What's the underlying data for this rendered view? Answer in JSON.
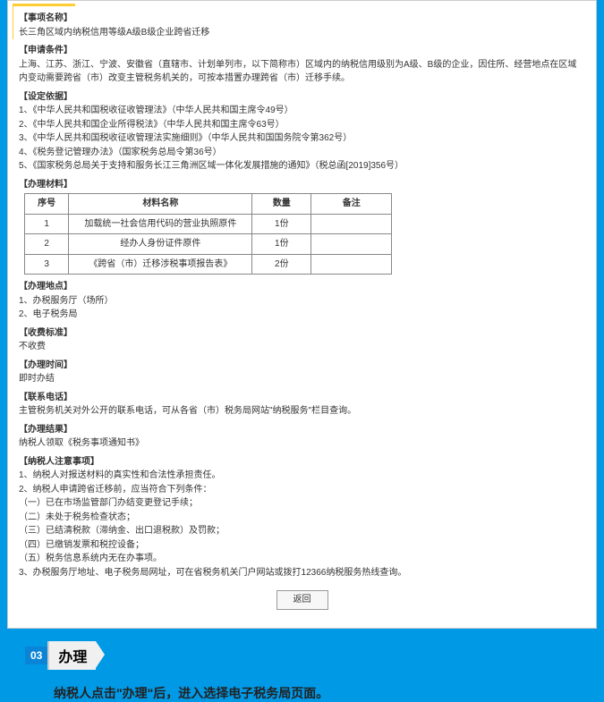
{
  "item_name": {
    "label": "【事项名称】",
    "text": "长三角区域内纳税信用等级A级B级企业跨省迁移"
  },
  "conditions": {
    "label": "【申请条件】",
    "text": "上海、江苏、浙江、宁波、安徽省（直辖市、计划单列市，以下简称市）区域内的纳税信用级别为A级、B级的企业，因住所、经营地点在区域内变动需要跨省（市）改变主管税务机关的，可按本措置办理跨省（市）迁移手续。"
  },
  "basis": {
    "label": "【设定依据】",
    "items": [
      "1、《中华人民共和国税收征收管理法》（中华人民共和国主席令49号）",
      "2、《中华人民共和国企业所得税法》（中华人民共和国主席令63号）",
      "3、《中华人民共和国税收征收管理法实施细则》（中华人民共和国国务院令第362号）",
      "4、《税务登记管理办法》（国家税务总局令第36号）",
      "5、《国家税务总局关于支持和服务长江三角洲区域一体化发展措施的通知》（税总函[2019]356号）"
    ]
  },
  "materials": {
    "label": "【办理材料】",
    "headers": {
      "seq": "序号",
      "name": "材料名称",
      "qty": "数量",
      "note": "备注"
    },
    "rows": [
      {
        "seq": "1",
        "name": "加载统一社会信用代码的营业执照原件",
        "qty": "1份",
        "note": ""
      },
      {
        "seq": "2",
        "name": "经办人身份证件原件",
        "qty": "1份",
        "note": ""
      },
      {
        "seq": "3",
        "name": "《跨省（市）迁移涉税事项报告表》",
        "qty": "2份",
        "note": ""
      }
    ]
  },
  "location": {
    "label": "【办理地点】",
    "lines": [
      "1、办税服务厅（场所）",
      "2、电子税务局"
    ]
  },
  "fee": {
    "label": "【收费标准】",
    "text": "不收费"
  },
  "time": {
    "label": "【办理时间】",
    "text": "即时办结"
  },
  "phone": {
    "label": "【联系电话】",
    "text": "主管税务机关对外公开的联系电话，可从各省（市）税务局网站\"纳税服务\"栏目查询。"
  },
  "result": {
    "label": "【办理结果】",
    "text": "纳税人领取《税务事项通知书》"
  },
  "notes": {
    "label": "【纳税人注意事项】",
    "lines": [
      "1、纳税人对报送材料的真实性和合法性承担责任。",
      "2、纳税人申请跨省迁移前，应当符合下列条件：",
      "（一）已在市场监管部门办结变更登记手续；",
      "（二）未处于税务检查状态；",
      "（三）已结清税款（滞纳金、出口退税款）及罚款；",
      "（四）已缴销发票和税控设备；",
      "（五）税务信息系统内无在办事项。",
      "3、办税服务厅地址、电子税务局网址，可在省税务机关门户网站或拨打12366纳税服务热线查询。"
    ]
  },
  "back_btn": "返回",
  "step": {
    "num": "03",
    "title": "办理"
  },
  "desc": "纳税人点击\"办理\"后，进入选择电子税务局页面。"
}
